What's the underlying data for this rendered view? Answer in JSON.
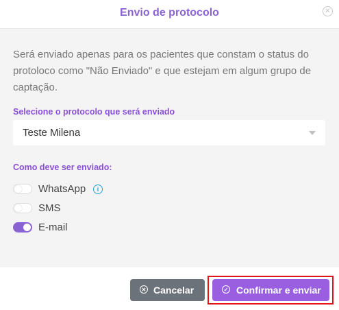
{
  "modal": {
    "title": "Envio de protocolo",
    "close_icon": "close-circle-icon"
  },
  "body": {
    "description": "Será enviado apenas para os pacientes que constam o status do protoloco como \"Não Enviado\" e que estejam em algum grupo de captação.",
    "protocol_label": "Selecione o protocolo que será enviado",
    "protocol_selected": "Teste Milena",
    "send_method_label": "Como deve ser enviado:",
    "options": [
      {
        "label": "WhatsApp",
        "enabled": false,
        "info_icon": "info-icon"
      },
      {
        "label": "SMS",
        "enabled": false
      },
      {
        "label": "E-mail",
        "enabled": true
      }
    ]
  },
  "footer": {
    "cancel_label": "Cancelar",
    "confirm_label": "Confirmar e enviar"
  },
  "colors": {
    "accent": "#8a63d2",
    "confirm": "#9a5fe0",
    "cancel": "#6b7279",
    "highlight": "#e0161a"
  }
}
